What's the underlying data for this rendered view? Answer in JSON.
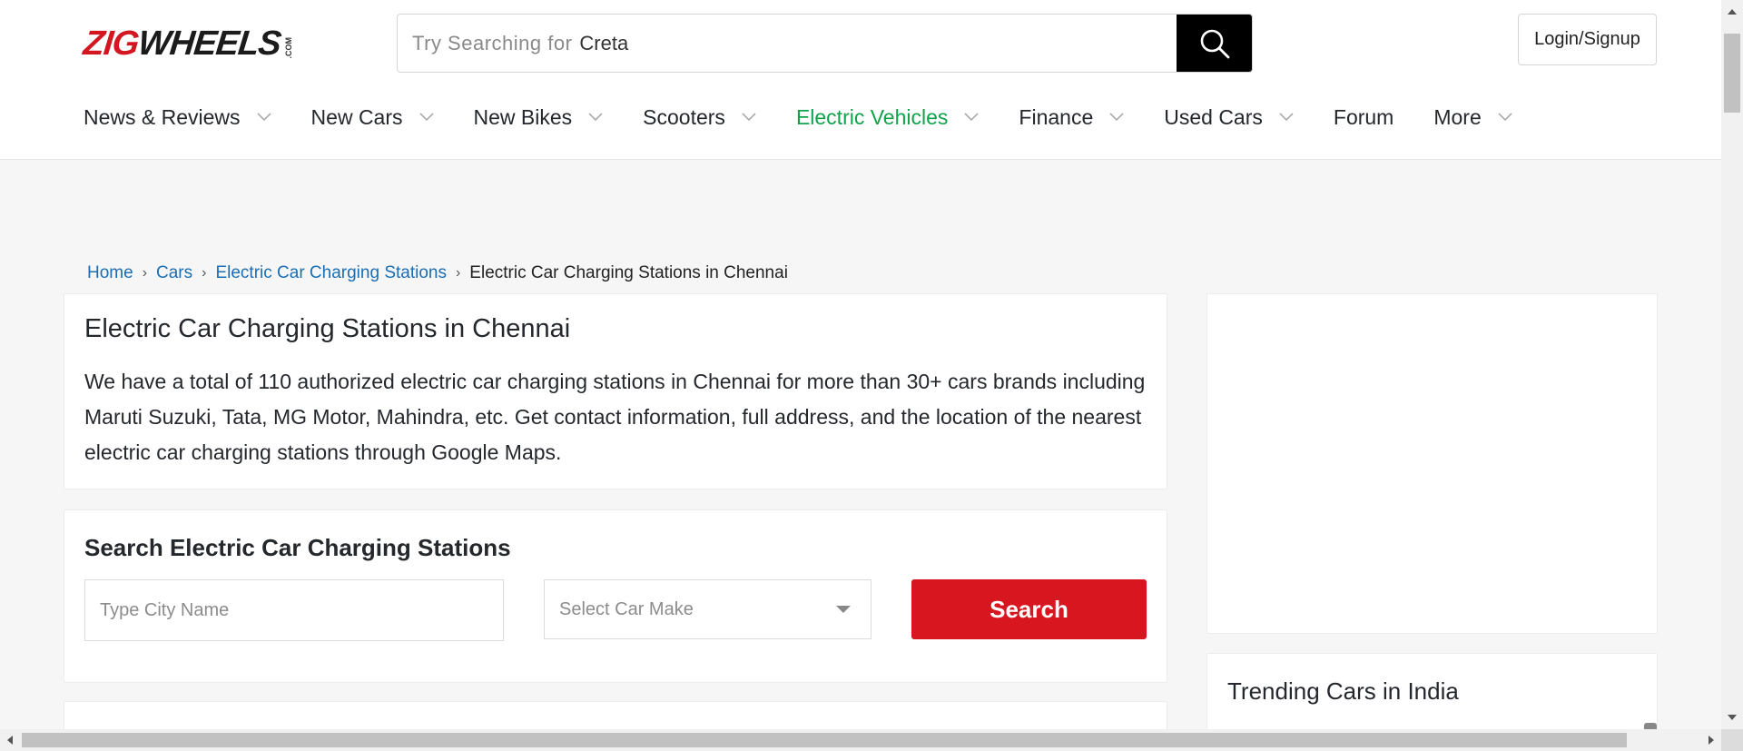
{
  "header": {
    "logo_part1": "ZIG",
    "logo_part2": "WHEELS",
    "logo_suffix": ".COM",
    "search_hint": "Try Searching for",
    "search_term": "Creta",
    "search_icon": "search-icon",
    "login_label": "Login/Signup"
  },
  "nav": {
    "items": [
      {
        "label": "News & Reviews",
        "dropdown": true
      },
      {
        "label": "New Cars",
        "dropdown": true
      },
      {
        "label": "New Bikes",
        "dropdown": true
      },
      {
        "label": "Scooters",
        "dropdown": true
      },
      {
        "label": "Electric Vehicles",
        "dropdown": true,
        "active": true
      },
      {
        "label": "Finance",
        "dropdown": true
      },
      {
        "label": "Used Cars",
        "dropdown": true
      },
      {
        "label": "Forum",
        "dropdown": false
      },
      {
        "label": "More",
        "dropdown": true
      }
    ],
    "active_color": "#12a24b"
  },
  "breadcrumb": {
    "items": [
      "Home",
      "Cars",
      "Electric Car Charging Stations"
    ],
    "current": "Electric Car Charging Stations in Chennai",
    "separator": "›"
  },
  "intro": {
    "title": "Electric Car Charging Stations in Chennai",
    "text": "We have a total of 110 authorized electric car charging stations in Chennai for more than 30+ cars brands including Maruti Suzuki, Tata, MG Motor, Mahindra, etc. Get contact information, full address, and the location of the nearest electric car charging stations through Google Maps."
  },
  "station_search": {
    "title": "Search Electric Car Charging Stations",
    "city_placeholder": "Type City Name",
    "make_placeholder": "Select Car Make",
    "submit_label": "Search",
    "submit_color": "#d7161f"
  },
  "sidebar": {
    "trending_title": "Trending Cars in India"
  }
}
